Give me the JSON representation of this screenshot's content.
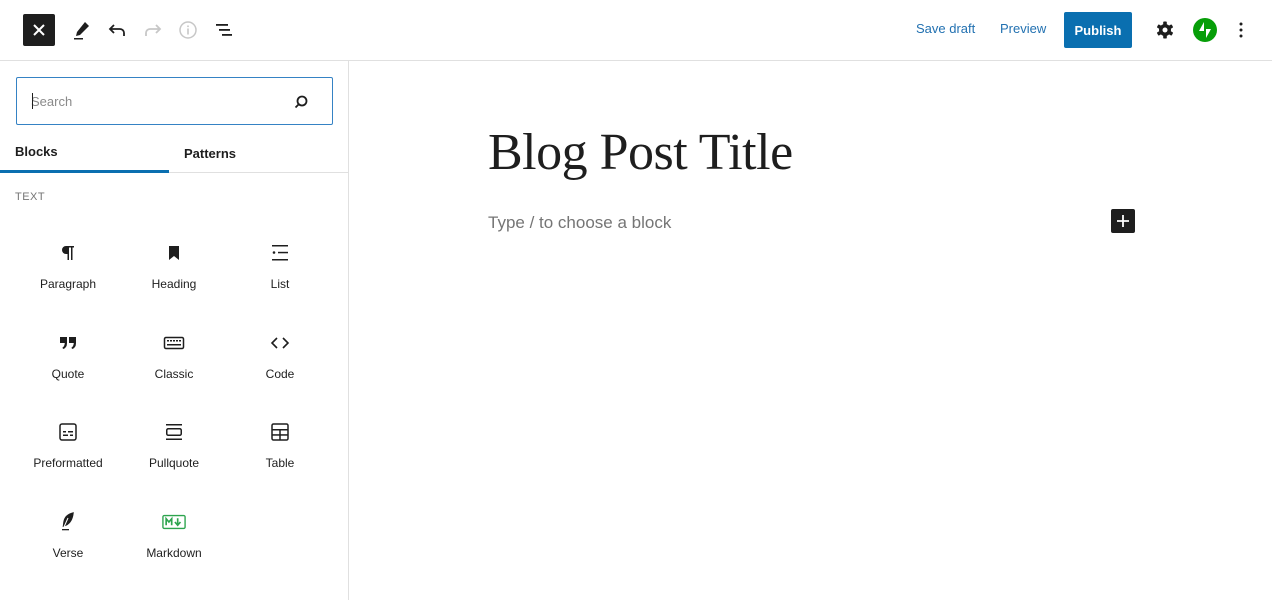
{
  "header": {
    "close_label": "Close",
    "tools": [
      {
        "name": "edit-icon",
        "label": "Tools"
      },
      {
        "name": "undo-icon",
        "label": "Undo"
      },
      {
        "name": "redo-icon",
        "label": "Redo"
      },
      {
        "name": "info-icon",
        "label": "Details"
      },
      {
        "name": "list-view-icon",
        "label": "List View"
      }
    ],
    "save_draft_label": "Save draft",
    "preview_label": "Preview",
    "publish_label": "Publish",
    "settings_label": "Settings",
    "jetpack_label": "Jetpack",
    "options_label": "Options"
  },
  "colors": {
    "accent": "#0a6fb0",
    "link": "#2271b1",
    "jetpack_green": "#069e08",
    "markdown_green": "#2da44e"
  },
  "sidebar": {
    "search": {
      "value": "",
      "placeholder": "Search"
    },
    "tabs": [
      {
        "label": "Blocks",
        "active": true
      },
      {
        "label": "Patterns",
        "active": false
      }
    ],
    "section_label": "TEXT",
    "blocks": [
      {
        "label": "Paragraph",
        "icon": "paragraph-icon"
      },
      {
        "label": "Heading",
        "icon": "bookmark-icon"
      },
      {
        "label": "List",
        "icon": "list-icon"
      },
      {
        "label": "Quote",
        "icon": "quote-icon"
      },
      {
        "label": "Classic",
        "icon": "keyboard-icon"
      },
      {
        "label": "Code",
        "icon": "code-icon"
      },
      {
        "label": "Preformatted",
        "icon": "preformatted-icon"
      },
      {
        "label": "Pullquote",
        "icon": "pullquote-icon"
      },
      {
        "label": "Table",
        "icon": "table-icon"
      },
      {
        "label": "Verse",
        "icon": "feather-icon"
      },
      {
        "label": "Markdown",
        "icon": "markdown-icon"
      }
    ]
  },
  "canvas": {
    "post_title": "Blog Post Title",
    "block_placeholder": "Type / to choose a block",
    "inserter_label": "Add block"
  }
}
